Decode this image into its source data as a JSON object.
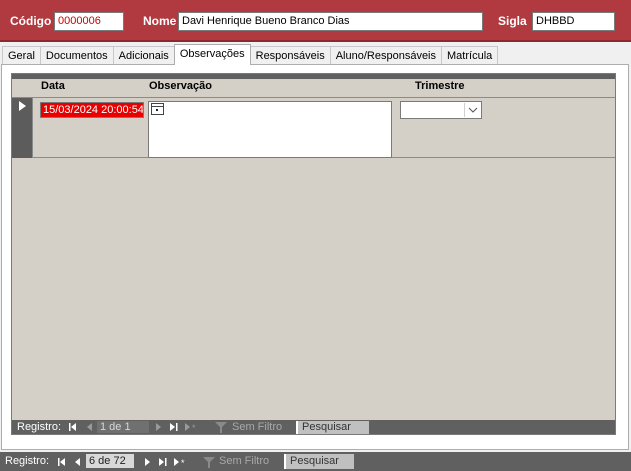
{
  "header": {
    "codigo_label": "Código",
    "codigo_value": "0000006",
    "nome_label": "Nome",
    "nome_value": "Davi Henrique Bueno Branco Dias",
    "sigla_label": "Sigla",
    "sigla_value": "DHBBD"
  },
  "tabs": [
    {
      "label": "Geral"
    },
    {
      "label": "Documentos"
    },
    {
      "label": "Adicionais"
    },
    {
      "label": "Observações",
      "active": true
    },
    {
      "label": "Responsáveis"
    },
    {
      "label": "Aluno/Responsáveis"
    },
    {
      "label": "Matrícula"
    }
  ],
  "subform": {
    "columns": {
      "data": "Data",
      "observacao": "Observação",
      "trimestre": "Trimestre"
    },
    "row": {
      "data": "15/03/2024 20:00:54",
      "observacao": "",
      "trimestre": ""
    }
  },
  "subnav": {
    "registro_label": "Registro:",
    "position": "1 de 1",
    "filter_label": "Sem Filtro",
    "search_placeholder": "Pesquisar"
  },
  "mainnav": {
    "registro_label": "Registro:",
    "position": "6 de 72",
    "filter_label": "Sem Filtro",
    "search_placeholder": "Pesquisar"
  },
  "colors": {
    "header_bg": "#b03a3f",
    "date_highlight": "#e80000",
    "nav_bg": "#606060"
  }
}
